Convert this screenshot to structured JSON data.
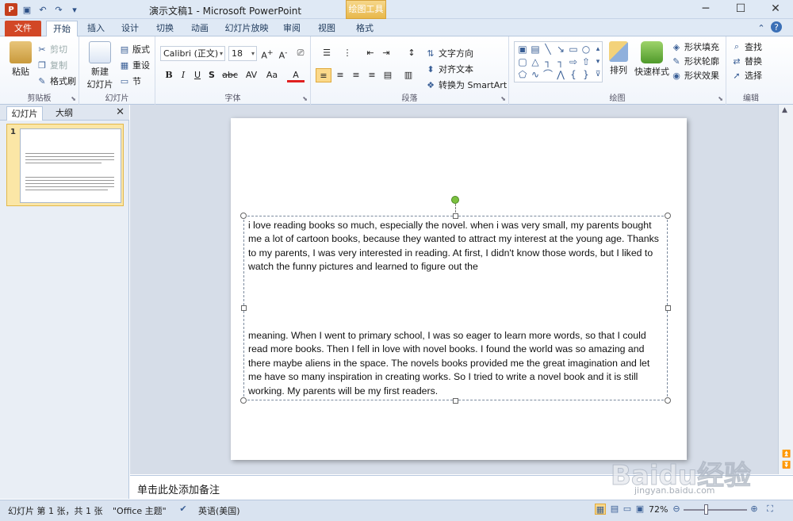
{
  "titlebar": {
    "app_title": "演示文稿1 - Microsoft PowerPoint",
    "context_tab": "绘图工具",
    "buttons": {
      "minimize": "─",
      "maximize": "☐",
      "close": "✕"
    }
  },
  "tabs": [
    {
      "label": "文件"
    },
    {
      "label": "开始"
    },
    {
      "label": "插入"
    },
    {
      "label": "设计"
    },
    {
      "label": "切换"
    },
    {
      "label": "动画"
    },
    {
      "label": "幻灯片放映"
    },
    {
      "label": "审阅"
    },
    {
      "label": "视图"
    },
    {
      "label": "格式"
    }
  ],
  "ribbon": {
    "clipboard": {
      "label": "剪贴板",
      "paste": "粘贴",
      "cut": "剪切",
      "copy": "复制",
      "format_painter": "格式刷"
    },
    "slides": {
      "label": "幻灯片",
      "new_slide": "新建",
      "new_slide2": "幻灯片",
      "layout": "版式",
      "reset": "重设",
      "section": "节"
    },
    "font": {
      "label": "字体",
      "font_name": "Calibri (正文)",
      "font_size": "18"
    },
    "paragraph": {
      "label": "段落",
      "text_direction": "文字方向",
      "align_text": "对齐文本",
      "smartart": "转换为 SmartArt"
    },
    "drawing": {
      "label": "绘图",
      "arrange": "排列",
      "quick_styles": "快速样式",
      "shape_fill": "形状填充",
      "shape_outline": "形状轮廓",
      "shape_effects": "形状效果"
    },
    "editing": {
      "label": "编辑",
      "find": "查找",
      "replace": "替换",
      "select": "选择"
    }
  },
  "left_panel": {
    "tab_slides": "幻灯片",
    "tab_outline": "大纲",
    "close": "✕",
    "slide_number": "1"
  },
  "slide": {
    "para1": "i love reading books so much, especially the novel. when i was very small, my parents bought me a lot of cartoon books, because they wanted to attract my interest at the young age. Thanks to my parents, I was very interested in reading. At first, I didn't know those words, but I liked to watch the funny pictures and learned to figure out the",
    "para2": "meaning. When I went to primary school, I was so eager to learn more words, so that I could read more books. Then I fell in love with novel books. I found the world was so amazing and there maybe aliens in the space. The novels books provided me the great imagination and let me have so many inspiration in creating works. So I tried to write a novel book and it is still working. My parents will be my first readers."
  },
  "notes": {
    "placeholder": "单击此处添加备注"
  },
  "status": {
    "slide_info": "幻灯片 第 1 张，共 1 张",
    "theme": "\"Office 主题\"",
    "language": "英语(美国)",
    "zoom": "72%"
  },
  "watermark": {
    "brand": "Baidu经验",
    "url": "jingyan.baidu.com"
  }
}
